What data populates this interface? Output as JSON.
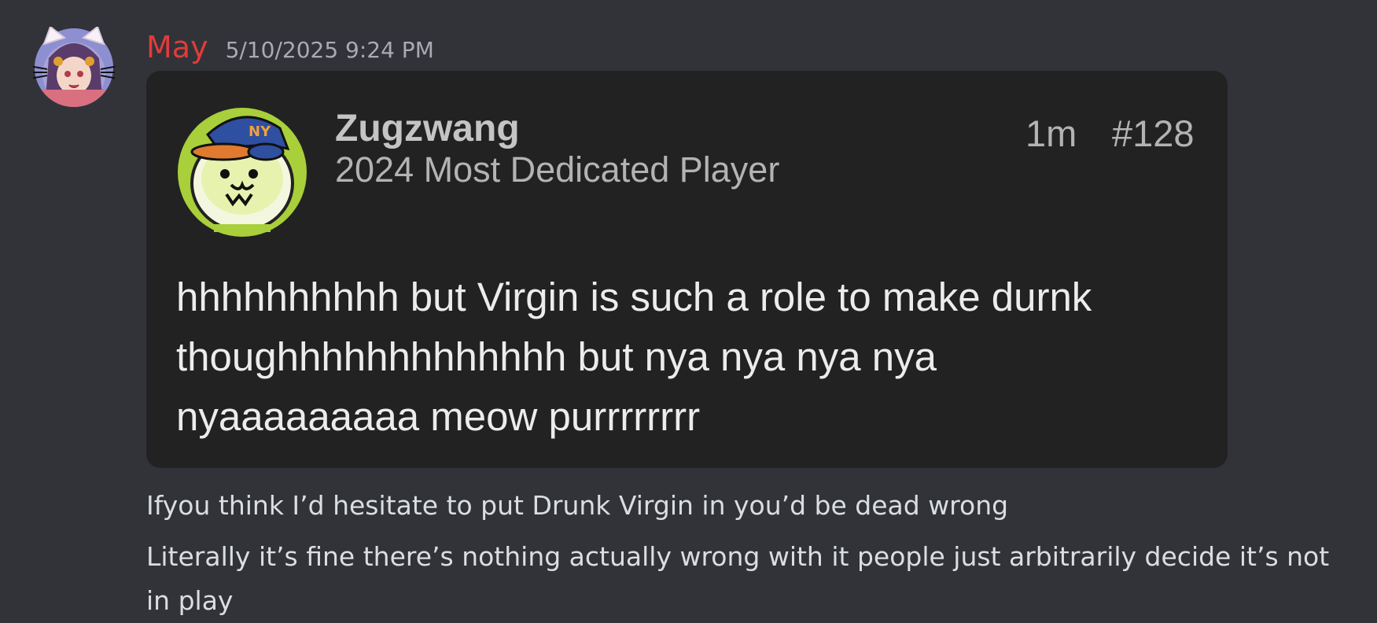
{
  "message": {
    "author": "May",
    "timestamp": "5/10/2025 9:24 PM",
    "author_color": "#e23b3b",
    "avatar_icon": "anime-catgirl-avatar-icon"
  },
  "embed": {
    "username": "Zugzwang",
    "user_title": "2024 Most Dedicated Player",
    "time_ago": "1m",
    "post_number": "#128",
    "avatar_icon": "cat-with-cap-avatar-icon",
    "body_lines": [
      "hhhhhhhhhh but Virgin is such a role to make durnk",
      "thoughhhhhhhhhhhhh but nya nya nya nya",
      "nyaaaaaaaaa meow purrrrrrrr"
    ]
  },
  "text_lines": [
    "Ifyou think I’d hesitate to put Drunk Virgin in you’d be dead wrong",
    "Literally it’s fine there’s nothing actually wrong with it people just arbitrarily decide it’s not",
    "in play"
  ]
}
